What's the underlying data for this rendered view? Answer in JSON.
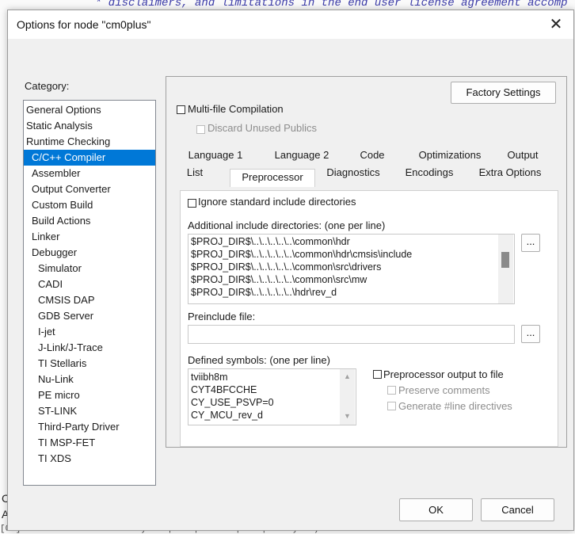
{
  "background": {
    "code_line": "* disclaimers, and limitations in the end user license agreement accomp",
    "code_star": "*",
    "bottom_text": "[00] MTB: Loco buffer memory Loc|s ch|m : loc|s ch|rts bytes)",
    "left_c": "C",
    "left_a": "A"
  },
  "dialog": {
    "title": "Options for node \"cm0plus\"",
    "close_icon": "close-icon"
  },
  "category": {
    "label": "Category:",
    "items": [
      {
        "label": "General Options",
        "indent": 0
      },
      {
        "label": "Static Analysis",
        "indent": 0
      },
      {
        "label": "Runtime Checking",
        "indent": 0
      },
      {
        "label": "C/C++ Compiler",
        "indent": 1,
        "selected": true
      },
      {
        "label": "Assembler",
        "indent": 1
      },
      {
        "label": "Output Converter",
        "indent": 1
      },
      {
        "label": "Custom Build",
        "indent": 1
      },
      {
        "label": "Build Actions",
        "indent": 1
      },
      {
        "label": "Linker",
        "indent": 1
      },
      {
        "label": "Debugger",
        "indent": 1
      },
      {
        "label": "Simulator",
        "indent": 2
      },
      {
        "label": "CADI",
        "indent": 2
      },
      {
        "label": "CMSIS DAP",
        "indent": 2
      },
      {
        "label": "GDB Server",
        "indent": 2
      },
      {
        "label": "I-jet",
        "indent": 2
      },
      {
        "label": "J-Link/J-Trace",
        "indent": 2
      },
      {
        "label": "TI Stellaris",
        "indent": 2
      },
      {
        "label": "Nu-Link",
        "indent": 2
      },
      {
        "label": "PE micro",
        "indent": 2
      },
      {
        "label": "ST-LINK",
        "indent": 2
      },
      {
        "label": "Third-Party Driver",
        "indent": 2
      },
      {
        "label": "TI MSP-FET",
        "indent": 2
      },
      {
        "label": "TI XDS",
        "indent": 2
      }
    ]
  },
  "factory_settings": "Factory Settings",
  "multi_file": "Multi-file Compilation",
  "discard_unused": "Discard Unused Publics",
  "tabs_row1": [
    "Language 1",
    "Language 2",
    "Code",
    "Optimizations",
    "Output"
  ],
  "tabs_row2": [
    "List",
    "Preprocessor",
    "Diagnostics",
    "Encodings",
    "Extra Options"
  ],
  "preprocessor": {
    "ignore_std": "Ignore standard include directories",
    "include_label": "Additional include directories: (one per line)",
    "include_dirs": [
      "$PROJ_DIR$\\..\\..\\..\\..\\..\\common\\hdr",
      "$PROJ_DIR$\\..\\..\\..\\..\\..\\common\\hdr\\cmsis\\include",
      "$PROJ_DIR$\\..\\..\\..\\..\\..\\common\\src\\drivers",
      "$PROJ_DIR$\\..\\..\\..\\..\\..\\common\\src\\mw",
      "$PROJ_DIR$\\..\\..\\..\\..\\..\\hdr\\rev_d"
    ],
    "browse_label": "...",
    "preinclude_label": "Preinclude file:",
    "preinclude_value": "",
    "defined_label": "Defined symbols: (one per line)",
    "defined_symbols": [
      "tviibh8m",
      "CYT4BFCCHE",
      "CY_USE_PSVP=0",
      "CY_MCU_rev_d"
    ],
    "pp_output": "Preprocessor output to file",
    "preserve_comments": "Preserve comments",
    "generate_line": "Generate #line directives"
  },
  "buttons": {
    "ok": "OK",
    "cancel": "Cancel"
  },
  "colors": {
    "selection": "#0078d7",
    "dialog_bg": "#f0f0f0"
  }
}
